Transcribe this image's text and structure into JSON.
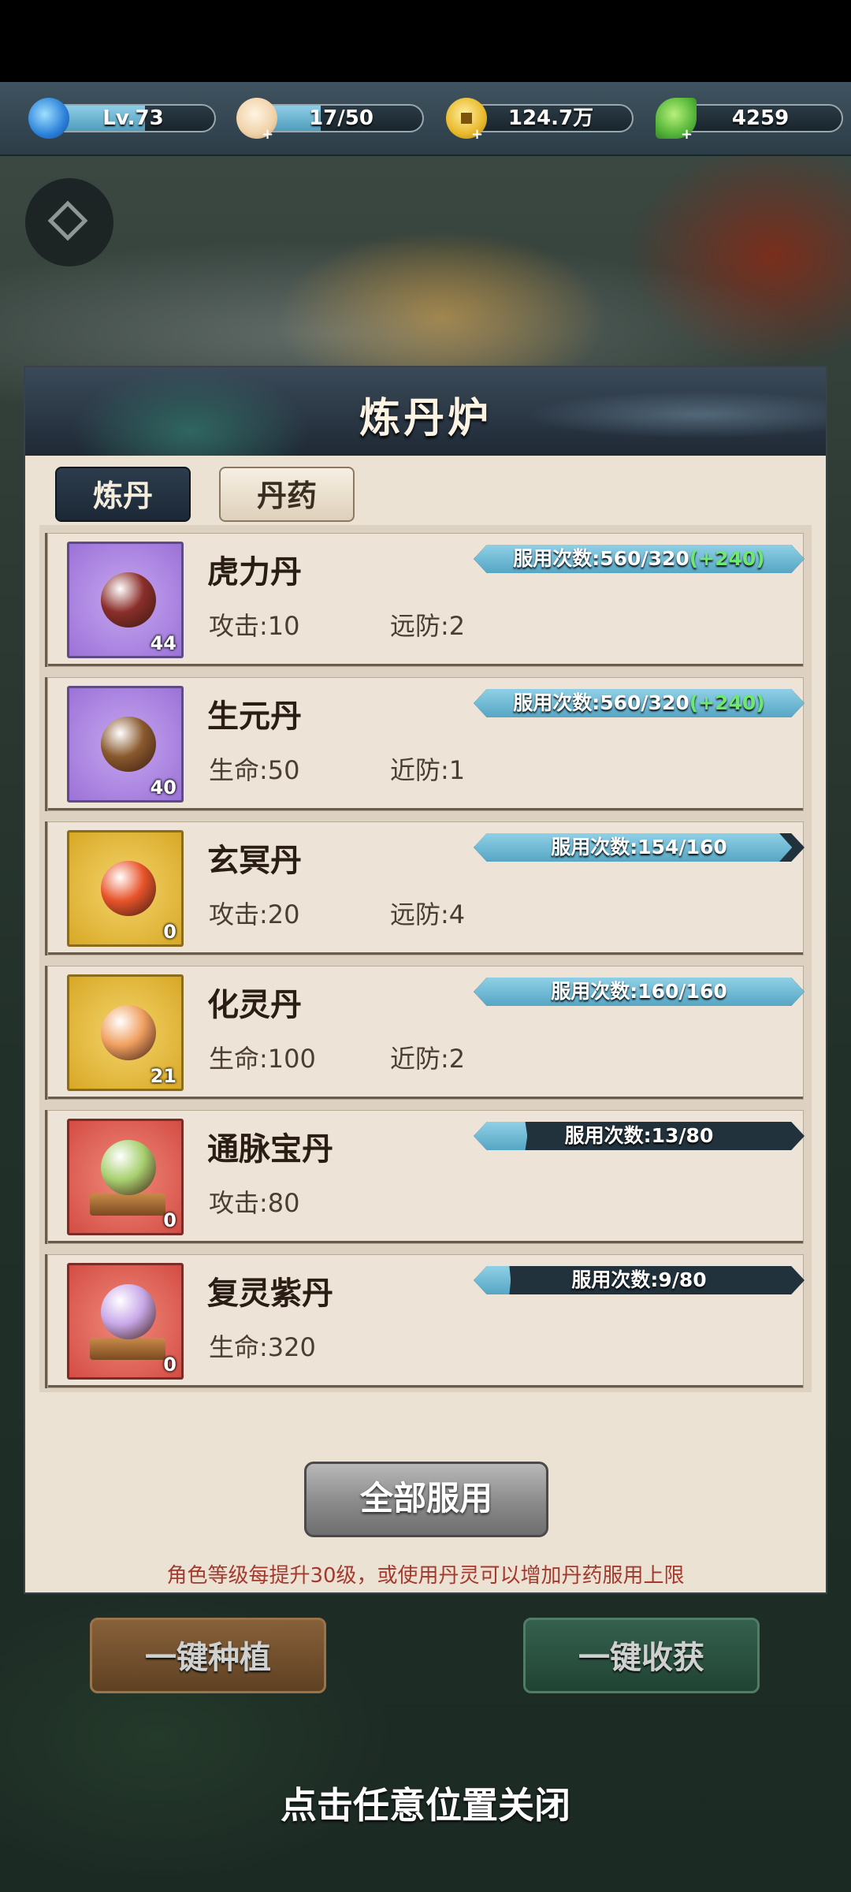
{
  "resources": [
    {
      "name": "level",
      "icon": "swirl-icon",
      "value": "Lv.73",
      "fill": 0.55
    },
    {
      "name": "stamina",
      "icon": "bun-icon",
      "value": "17/50",
      "fill": 0.34
    },
    {
      "name": "coins",
      "icon": "coin-icon",
      "value": "124.7万",
      "fill": 0.0
    },
    {
      "name": "jade",
      "icon": "leaf-icon",
      "value": "4259",
      "fill": 0.0
    }
  ],
  "panel": {
    "title": "炼丹炉",
    "tabs": [
      {
        "label": "炼丹",
        "active": true
      },
      {
        "label": "丹药",
        "active": false
      }
    ],
    "items": [
      {
        "name": "虎力丹",
        "count": "44",
        "tile": "purple",
        "orb": "#8a2e2a",
        "stat1": "攻击:10",
        "stat2": "远防:2",
        "usage_prefix": "服用次数:560/320",
        "usage_bonus": "(+240)",
        "progress": 1.0
      },
      {
        "name": "生元丹",
        "count": "40",
        "tile": "purple",
        "orb": "#8a5a2e",
        "stat1": "生命:50",
        "stat2": "近防:1",
        "usage_prefix": "服用次数:560/320",
        "usage_bonus": "(+240)",
        "progress": 1.0
      },
      {
        "name": "玄冥丹",
        "count": "0",
        "tile": "gold",
        "orb": "#e8542a",
        "stat1": "攻击:20",
        "stat2": "远防:4",
        "usage_prefix": "服用次数:154/160",
        "usage_bonus": "",
        "progress": 0.9625
      },
      {
        "name": "化灵丹",
        "count": "21",
        "tile": "gold",
        "orb": "#f0a060",
        "stat1": "生命:100",
        "stat2": "近防:2",
        "usage_prefix": "服用次数:160/160",
        "usage_bonus": "",
        "progress": 1.0
      },
      {
        "name": "通脉宝丹",
        "count": "0",
        "tile": "red",
        "orb": "#a8d070",
        "stat1": "攻击:80",
        "stat2": "",
        "usage_prefix": "服用次数:13/80",
        "usage_bonus": "",
        "progress": 0.1625
      },
      {
        "name": "复灵紫丹",
        "count": "0",
        "tile": "red",
        "orb": "#c8a8e8",
        "stat1": "生命:320",
        "stat2": "",
        "usage_prefix": "服用次数:9/80",
        "usage_bonus": "",
        "progress": 0.1125
      }
    ],
    "consume_all_label": "全部服用",
    "hint": "角色等级每提升30级，或使用丹灵可以增加丹药服用上限"
  },
  "garden": {
    "plant_label": "一键种植",
    "harvest_label": "一键收获"
  },
  "close_hint": "点击任意位置关闭"
}
